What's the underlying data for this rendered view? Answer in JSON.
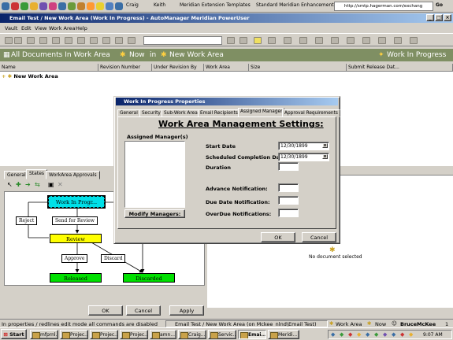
{
  "browser": {
    "links": [
      "Craig",
      "Keith",
      "Meridian Extension Templates",
      "Standard Meridian Enhancements"
    ],
    "address": "http://smtp.hagerman.com/exchang",
    "go_label": "Go"
  },
  "window": {
    "title": "Email Test / New Work Area (Work In Progress) - AutoManager Meridian PowerUser"
  },
  "menu": [
    "Vault",
    "Edit",
    "View",
    "Work Area",
    "Help"
  ],
  "location_bar": {
    "scope": "All Documents In Work Area",
    "now": "Now",
    "in": "in",
    "area": "New Work Area",
    "state": "Work In Progress"
  },
  "list": {
    "columns": [
      "Name",
      "Revision Number",
      "Under Revision By",
      "Work Area",
      "Size",
      "Submit Release Dat..."
    ],
    "rows": [
      {
        "name": "New Work Area"
      }
    ]
  },
  "lower_left": {
    "tabs": [
      "General",
      "States",
      "WorkArea Approvals"
    ],
    "active_tab": "States",
    "diagram": {
      "nodes": {
        "wip": "Work In Progr...",
        "review": "Review",
        "released": "Released",
        "discarded": "Discarded"
      },
      "edges": {
        "reject": "Reject",
        "send_review": "Send for Review",
        "approve": "Approve",
        "discard": "Discard"
      }
    },
    "buttons": {
      "ok": "OK",
      "cancel": "Cancel",
      "apply": "Apply"
    }
  },
  "right_panel": {
    "empty_text": "No document selected"
  },
  "dialog": {
    "title": "Work In Progress Properties",
    "tabs": [
      "General",
      "Security",
      "Sub-Work Area",
      "Email Recipients",
      "Assigned Manager",
      "Approval Requirements"
    ],
    "active_tab": "Assigned Manager",
    "heading": "Work Area Management Settings:",
    "managers_label": "Assigned Manager(s)",
    "modify_button": "Modify Managers:",
    "fields": {
      "start_date_label": "Start Date",
      "start_date_value": "12/30/1899",
      "scd_label": "Scheduled Completion Date",
      "scd_value": "12/30/1899",
      "duration_label": "Duration",
      "advance_label": "Advance Notification:",
      "due_label": "Due Date Notification:",
      "overdue_label": "OverDue Notifications:"
    },
    "ok": "OK",
    "cancel": "Cancel"
  },
  "status": {
    "message": "In properties / redlines edit mode all commands are disabled",
    "context": "Email Test / New Work Area (on Mckee_nlnd\\Email Test)",
    "work_area": "Work Area",
    "now": "Now",
    "user": "BruceMcKee",
    "count": "1"
  },
  "taskbar": {
    "start": "Start",
    "tasks": [
      "mfprnl...",
      "Projec...",
      "Projec...",
      "Projec...",
      "amn...",
      "Craig...",
      "Servic...",
      "Emai...",
      "Meridi..."
    ],
    "clock": "9:07 AM"
  },
  "colors": {
    "title_start": "#0a246a",
    "title_end": "#a6caf0",
    "location_bar": "#7f8f63",
    "wip_node": "#00e0e8",
    "review_node": "#ffff00",
    "final_node": "#00e000"
  }
}
